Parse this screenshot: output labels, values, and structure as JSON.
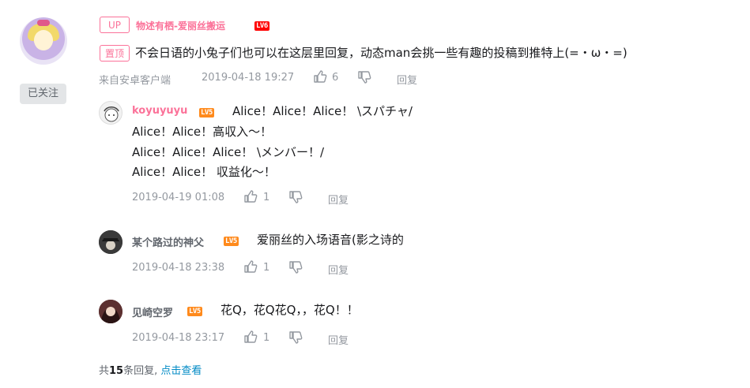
{
  "main_comment": {
    "up_tag": "UP",
    "username": "物述有栖-爱丽丝搬运",
    "level": "LV6",
    "pin_tag": "置顶",
    "text": "不会日语的小兔子们也可以在这层里回复，动态man会挑一些有趣的投稿到推特上(=・ω・=)",
    "source": "来自安卓客户端",
    "time": "2019-04-18 19:27",
    "likes": "6",
    "reply_label": "回复",
    "follow_label": "已关注"
  },
  "replies": [
    {
      "username": "koyuyuyu",
      "level": "LV5",
      "lines": [
        "Alice！Alice！Alice！  \\スパチャ/",
        "Alice！Alice！高収入～！",
        "Alice！Alice！Alice！  \\メンバー！/",
        "Alice！Alice！ 収益化～！"
      ],
      "time": "2019-04-19 01:08",
      "likes": "1",
      "reply_label": "回复"
    },
    {
      "username": "某个路过的神父",
      "level": "LV5",
      "lines": [
        "爱丽丝的入场语音(影之诗的"
      ],
      "time": "2019-04-18 23:38",
      "likes": "1",
      "reply_label": "回复"
    },
    {
      "username": "见崎空罗",
      "level": "LV5",
      "lines": [
        "花Q，花Q花Q，，花Q！！"
      ],
      "time": "2019-04-18 23:17",
      "likes": "1",
      "reply_label": "回复"
    }
  ],
  "summary": {
    "prefix": "共",
    "count": "15",
    "suffix": "条回复,",
    "link": "点击查看"
  },
  "colors": {
    "accent_pink": "#fb7299",
    "link_blue": "#008ac5",
    "lv6": "#ff0000",
    "lv5": "#ff8a1c"
  }
}
